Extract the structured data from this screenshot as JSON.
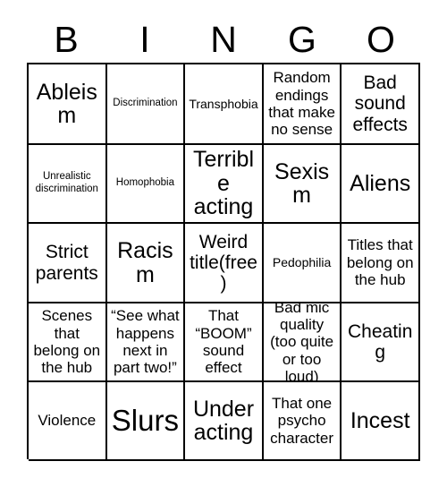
{
  "header": {
    "letters": [
      "B",
      "I",
      "N",
      "G",
      "O"
    ]
  },
  "grid": {
    "columns": 5,
    "rows": 5,
    "free_space": "Weird title(free)",
    "cells": [
      [
        {
          "text": "Ableism",
          "size": "lg"
        },
        {
          "text": "Discrimination",
          "size": "xxs"
        },
        {
          "text": "Transphobia",
          "size": "xs"
        },
        {
          "text": "Random endings that make no sense",
          "size": "sm"
        },
        {
          "text": "Bad sound effects",
          "size": "md"
        }
      ],
      [
        {
          "text": "Unrealistic discrimination",
          "size": "xxs"
        },
        {
          "text": "Homophobia",
          "size": "xxs"
        },
        {
          "text": "Terrible acting",
          "size": "lg"
        },
        {
          "text": "Sexism",
          "size": "lg"
        },
        {
          "text": "Aliens",
          "size": "lg"
        }
      ],
      [
        {
          "text": "Strict parents",
          "size": "md"
        },
        {
          "text": "Racism",
          "size": "lg"
        },
        {
          "text": "Weird title(free)",
          "size": "md"
        },
        {
          "text": "Pedophilia",
          "size": "xs"
        },
        {
          "text": "Titles that belong on the hub",
          "size": "sm"
        }
      ],
      [
        {
          "text": "Scenes that belong on the hub",
          "size": "sm"
        },
        {
          "text": "“See what happens next in part two!”",
          "size": "sm"
        },
        {
          "text": "That “BOOM” sound effect",
          "size": "sm"
        },
        {
          "text": "Bad mic quality (too quite or too loud)",
          "size": "sm"
        },
        {
          "text": "Cheating",
          "size": "md"
        }
      ],
      [
        {
          "text": "Violence",
          "size": "sm"
        },
        {
          "text": "Slurs",
          "size": "xl"
        },
        {
          "text": "Under acting",
          "size": "lg"
        },
        {
          "text": "That one psycho character",
          "size": "sm"
        },
        {
          "text": "Incest",
          "size": "lg"
        }
      ]
    ]
  },
  "colors": {
    "background": "#ffffff",
    "text": "#000000",
    "border": "#000000"
  }
}
